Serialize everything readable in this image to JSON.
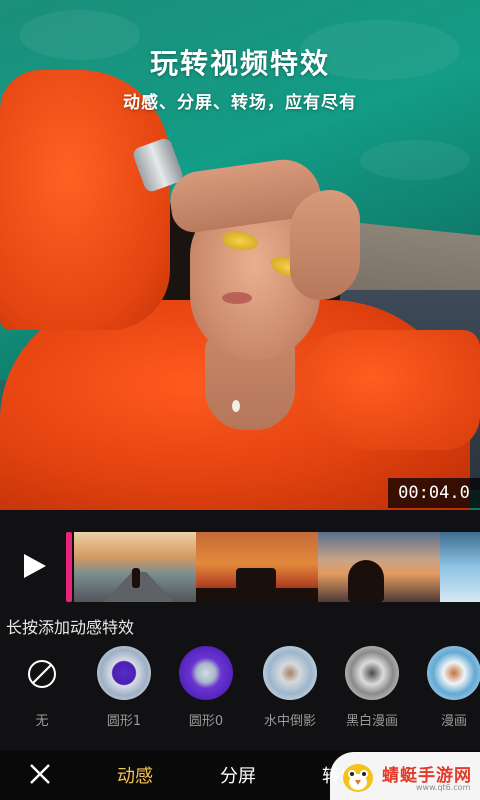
{
  "hero": {
    "title": "玩转视频特效",
    "subtitle": "动感、分屏、转场，应有尽有",
    "timecode": "00:04.0"
  },
  "effects": {
    "hint": "长按添加动感特效",
    "items": [
      {
        "label": "无",
        "icon": "none-icon"
      },
      {
        "label": "圆形1",
        "icon": "circle-1-thumb"
      },
      {
        "label": "圆形0",
        "icon": "circle-0-thumb"
      },
      {
        "label": "水中倒影",
        "icon": "water-reflection-thumb"
      },
      {
        "label": "黑白漫画",
        "icon": "bw-comic-thumb"
      },
      {
        "label": "漫画",
        "icon": "comic-thumb"
      }
    ]
  },
  "bottom_bar": {
    "close_icon": "close-icon",
    "tabs": [
      {
        "label": "动感",
        "active": true
      },
      {
        "label": "分屏",
        "active": false
      },
      {
        "label": "转场",
        "active": false
      }
    ]
  },
  "watermark": {
    "text": "蜻蜓手游网",
    "sub": "www.qt6.com"
  },
  "colors": {
    "active_tab": "#f5c24a",
    "playhead": "#e8257d",
    "panel_bg": "#111113"
  }
}
